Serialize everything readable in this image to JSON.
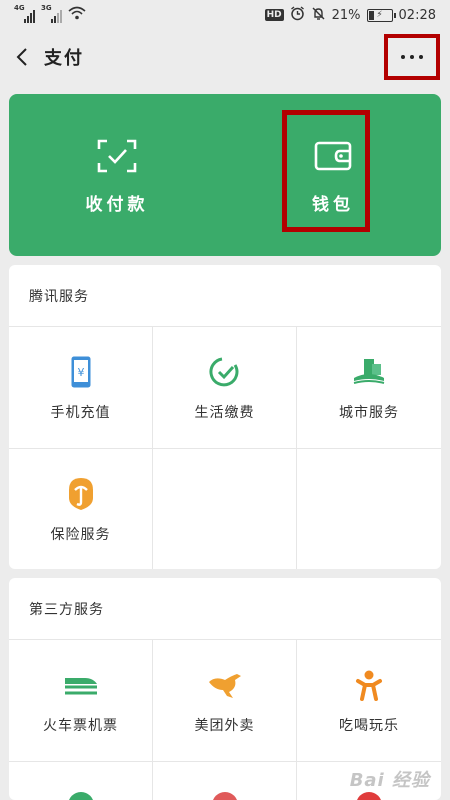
{
  "status_bar": {
    "network1": "4G",
    "network2": "3G",
    "hd": "HD",
    "battery_percent": "21%",
    "time": "02:28"
  },
  "header": {
    "title": "支付"
  },
  "banner": {
    "collect_pay_label": "收付款",
    "wallet_label": "钱包",
    "color": "#3aab6a"
  },
  "tencent_services": {
    "title": "腾讯服务",
    "items": [
      {
        "label": "手机充值",
        "icon": "phone-icon"
      },
      {
        "label": "生活缴费",
        "icon": "bill-icon"
      },
      {
        "label": "城市服务",
        "icon": "city-icon"
      },
      {
        "label": "保险服务",
        "icon": "insurance-icon"
      }
    ]
  },
  "third_party_services": {
    "title": "第三方服务",
    "items": [
      {
        "label": "火车票机票",
        "icon": "train-icon"
      },
      {
        "label": "美团外卖",
        "icon": "kangaroo-icon"
      },
      {
        "label": "吃喝玩乐",
        "icon": "person-icon"
      }
    ]
  },
  "watermark": "Bai 经验"
}
